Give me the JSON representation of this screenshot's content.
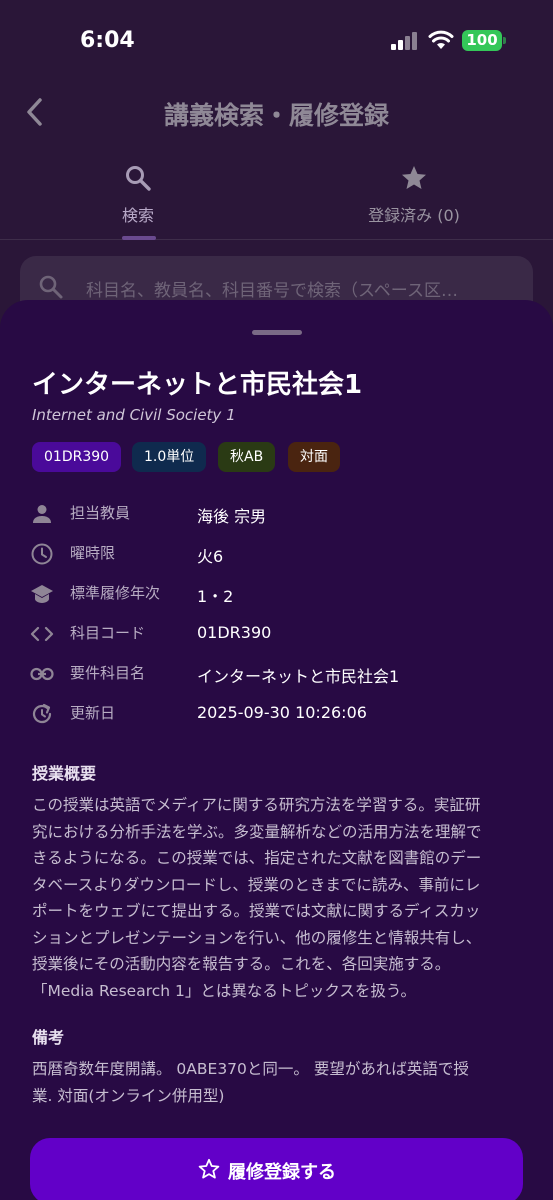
{
  "status": {
    "time": "6:04",
    "battery": "100"
  },
  "header": {
    "title": "講義検索・履修登録"
  },
  "tabs": [
    {
      "label": "検索"
    },
    {
      "label": "登録済み (0)"
    }
  ],
  "search": {
    "placeholder": "科目名、教員名、科目番号で検索（スペース区…"
  },
  "course": {
    "title": "インターネットと市民社会1",
    "subtitle": "Internet and Civil Society 1",
    "chips": [
      {
        "label": "01DR390",
        "color": "#4a0a9a"
      },
      {
        "label": "1.0単位",
        "color": "#0f2a4e"
      },
      {
        "label": "秋AB",
        "color": "#2a3a14"
      },
      {
        "label": "対面",
        "color": "#4a2410"
      }
    ],
    "rows": [
      {
        "icon": "person-icon",
        "key": "担当教員",
        "value": "海後 宗男"
      },
      {
        "icon": "clock-icon",
        "key": "曜時限",
        "value": "火6"
      },
      {
        "icon": "school-icon",
        "key": "標準履修年次",
        "value": "1・2"
      },
      {
        "icon": "code-icon",
        "key": "科目コード",
        "value": "01DR390"
      },
      {
        "icon": "link-icon",
        "key": "要件科目名",
        "value": "インターネットと市民社会1"
      },
      {
        "icon": "update-icon",
        "key": "更新日",
        "value": "2025-09-30 10:26:06"
      }
    ],
    "summary_title": "授業概要",
    "summary_lines": [
      "この授業は英語でメディアに関する研究方法を学習する。実証研",
      "究における分析手法を学ぶ。多変量解析などの活用方法を理解で",
      "きるようになる。この授業では、指定された文献を図書館のデー",
      "タベースよりダウンロードし、授業のときまでに読み、事前にレ",
      "ポートをウェブにて提出する。授業では文献に関するディスカッ",
      "ションとプレゼンテーションを行い、他の履修生と情報共有し、",
      "授業後にその活動内容を報告する。これを、各回実施する。",
      "「Media Research 1」とは異なるトピックスを扱う。"
    ],
    "notes_title": "備考",
    "notes_lines": [
      "西暦奇数年度開講。 0ABE370と同一。 要望があれば英語で授",
      "業. 対面(オンライン併用型)"
    ]
  },
  "cta": {
    "label": "履修登録する",
    "icon": "star-outline-icon"
  },
  "colors": {
    "sheet": "#280a44",
    "cta": "#6200c8",
    "battery": "#34c759"
  }
}
